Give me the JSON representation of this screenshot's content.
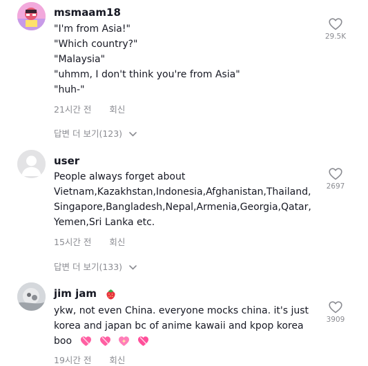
{
  "comments": [
    {
      "username": "msmaam18",
      "lines": [
        "\"I'm from Asia!\"",
        "\"Which country?\"",
        "\"Malaysia\"",
        "\"uhmm, I don't think you're from Asia\"",
        "\"huh-\""
      ],
      "time": "21시간 전",
      "reply_label": "회신",
      "view_replies": "답변 더 보기(123)",
      "likes": "29.5K"
    },
    {
      "username": "user",
      "lines": [
        "People always forget about",
        "Vietnam,Kazakhstan,Indonesia,Afghanistan,Thailand,",
        "Singapore,Bangladesh,Nepal,Armenia,Georgia,Qatar,",
        "Yemen,Sri Lanka etc."
      ],
      "time": "15시간 전",
      "reply_label": "회신",
      "view_replies": "답변 더 보기(133)",
      "likes": "2697"
    },
    {
      "username": "jim jam",
      "username_badge_icon": "strawberry-icon",
      "lines": [
        "ykw, not even China. everyone mocks china. it's just",
        "korea and japan bc of anime kawaii and kpop korea",
        "boo"
      ],
      "trailing_icons": [
        "heart-gift-icon",
        "heart-gift-icon",
        "sparkling-heart-icon",
        "heart-gift-icon"
      ],
      "time": "19시간 전",
      "reply_label": "회신",
      "likes": "3909"
    }
  ],
  "colors": {
    "text": "#161823",
    "muted": "#8a8b91",
    "heart_stroke": "#8a8b91",
    "pink": "#ff4f9a"
  }
}
